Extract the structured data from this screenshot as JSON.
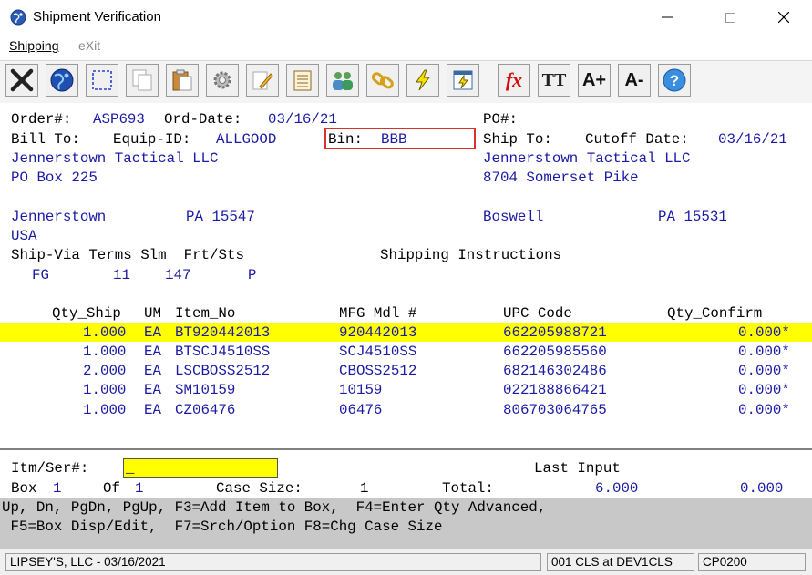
{
  "window": {
    "title": "Shipment Verification",
    "minimize": "—",
    "maximize": "☐",
    "close": "✕"
  },
  "menu": {
    "shipping_label": "Shipping",
    "exit_label": "eXit"
  },
  "toolbar": {
    "fx_label": "fx",
    "tt_label": "TT",
    "font_up_label": "A+",
    "font_down_label": "A-"
  },
  "header": {
    "order_label": "Order#:",
    "order_value": "ASP693",
    "orddate_label": "Ord-Date:",
    "orddate_value": "03/16/21",
    "po_label": "PO#:",
    "billto_label": "Bill To:",
    "equip_label": "Equip-ID:",
    "equip_value": "ALLGOOD",
    "bin_label": "Bin:",
    "bin_value": "BBB",
    "shipto_label": "Ship To:",
    "cutoff_label": "Cutoff Date:",
    "cutoff_value": "03/16/21"
  },
  "bill_to": {
    "name": "Jennerstown Tactical LLC",
    "address1": "PO Box 225",
    "city": "Jennerstown",
    "state_zip": "PA 15547",
    "country": "USA"
  },
  "ship_to": {
    "name": "Jennerstown Tactical LLC",
    "address1": "8704 Somerset Pike",
    "city": "Boswell",
    "state_zip": "PA 15531"
  },
  "shipping": {
    "labels": "Ship-Via Terms Slm  Frt/Sts",
    "instructions_label": "Shipping Instructions",
    "ship_via": "FG",
    "terms": "11",
    "slm": "147",
    "frt_sts": "P"
  },
  "table": {
    "headers": {
      "qty_ship": "Qty_Ship",
      "um": "UM",
      "item_no": "Item_No",
      "mfg_mdl": "MFG Mdl #",
      "upc": "UPC Code",
      "qty_confirm": "Qty_Confirm"
    },
    "rows": [
      {
        "qty_ship": "1.000",
        "um": "EA",
        "item_no": "BT920442013",
        "mfg_mdl": "920442013",
        "upc": "662205988721",
        "qty_confirm": "0.000*"
      },
      {
        "qty_ship": "1.000",
        "um": "EA",
        "item_no": "BTSCJ4510SS",
        "mfg_mdl": "SCJ4510SS",
        "upc": "662205985560",
        "qty_confirm": "0.000*"
      },
      {
        "qty_ship": "2.000",
        "um": "EA",
        "item_no": "LSCBOSS2512",
        "mfg_mdl": "CBOSS2512",
        "upc": "682146302486",
        "qty_confirm": "0.000*"
      },
      {
        "qty_ship": "1.000",
        "um": "EA",
        "item_no": "SM10159",
        "mfg_mdl": "10159",
        "upc": "022188866421",
        "qty_confirm": "0.000*"
      },
      {
        "qty_ship": "1.000",
        "um": "EA",
        "item_no": "CZ06476",
        "mfg_mdl": "06476",
        "upc": "806703064765",
        "qty_confirm": "0.000*"
      }
    ]
  },
  "entry": {
    "itm_label": "Itm/Ser#:",
    "itm_value": "_",
    "last_input_label": "Last Input",
    "box_label": "Box",
    "box_value": "1",
    "of_label": "Of",
    "of_value": "1",
    "case_size_label": "Case Size:",
    "case_size_value": "1",
    "total_label": "Total:",
    "total_value": "6.000",
    "last_input_value": "0.000"
  },
  "keys": {
    "line1": "Up, Dn, PgDn, PgUp, F3=Add Item to Box,  F4=Enter Qty Advanced,",
    "line2": " F5=Box Disp/Edit,  F7=Srch/Option F8=Chg Case Size"
  },
  "status": {
    "company": "LIPSEY'S, LLC - 03/16/2021",
    "session": "001 CLS at DEV1CLS",
    "program": "CP0200"
  },
  "colors": {
    "highlight": "#ffff00",
    "terminal_blue": "#1a1aa6",
    "bin_box": "#d93030",
    "keys_bg": "#c8c8c8"
  }
}
